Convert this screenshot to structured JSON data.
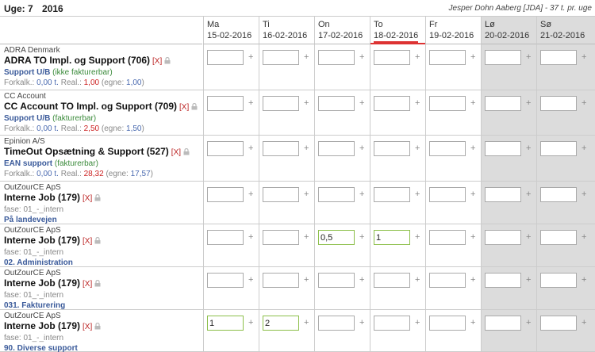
{
  "week": {
    "label": "Uge: 7",
    "year": "2016"
  },
  "user_info": "Jesper Dohn Aaberg [JDA] - 37 t. pr. uge",
  "days": [
    {
      "name": "Ma",
      "date": "15-02-2016"
    },
    {
      "name": "Ti",
      "date": "16-02-2016"
    },
    {
      "name": "On",
      "date": "17-02-2016"
    },
    {
      "name": "To",
      "date": "18-02-2016"
    },
    {
      "name": "Fr",
      "date": "19-02-2016"
    },
    {
      "name": "Lø",
      "date": "20-02-2016"
    },
    {
      "name": "Sø",
      "date": "21-02-2016"
    }
  ],
  "plus_glyph": "+",
  "remove_label": "[X]",
  "rows": [
    {
      "company": "ADRA Denmark",
      "job": "ADRA TO Impl. og Support (706)",
      "task": "Support U/B",
      "billing": "(ikke fakturerbar)",
      "forkalk_label": "Forkalk.:",
      "forkalk": "0,00 t.",
      "real_label": "Real.:",
      "real": "1,00",
      "egne_label": "(egne:",
      "egne": "1,00",
      "egne_close": ")",
      "hours": [
        "",
        "",
        "",
        "",
        "",
        "",
        ""
      ]
    },
    {
      "company": "CC Account",
      "job": "CC Account TO Impl. og Support (709)",
      "task": "Support U/B",
      "billing": "(fakturerbar)",
      "forkalk_label": "Forkalk.:",
      "forkalk": "0,00 t.",
      "real_label": "Real.:",
      "real": "2,50",
      "egne_label": "(egne:",
      "egne": "1,50",
      "egne_close": ")",
      "hours": [
        "",
        "",
        "",
        "",
        "",
        "",
        ""
      ]
    },
    {
      "company": "Epinion A/S",
      "job": "TimeOut Opsætning & Support (527)",
      "task": "EAN support",
      "billing": "(fakturerbar)",
      "forkalk_label": "Forkalk.:",
      "forkalk": "0,00 t.",
      "real_label": "Real.:",
      "real": "28,32",
      "egne_label": "(egne:",
      "egne": "17,57",
      "egne_close": ")",
      "hours": [
        "",
        "",
        "",
        "",
        "",
        "",
        ""
      ]
    },
    {
      "company": "OutZourCE ApS",
      "job": "Interne Job (179)",
      "fase": "fase: 01_-_intern",
      "task": "På landevejen",
      "hours": [
        "",
        "",
        "",
        "",
        "",
        "",
        ""
      ]
    },
    {
      "company": "OutZourCE ApS",
      "job": "Interne Job (179)",
      "fase": "fase: 01_-_intern",
      "task": "02. Administration",
      "hours": [
        "",
        "",
        "0,5",
        "1",
        "",
        "",
        ""
      ]
    },
    {
      "company": "OutZourCE ApS",
      "job": "Interne Job (179)",
      "fase": "fase: 01_-_intern",
      "task": "031. Fakturering",
      "hours": [
        "",
        "",
        "",
        "",
        "",
        "",
        ""
      ]
    },
    {
      "company": "OutZourCE ApS",
      "job": "Interne Job (179)",
      "fase": "fase: 01_-_intern",
      "task": "90. Diverse support",
      "hours": [
        "1",
        "2",
        "",
        "",
        "",
        "",
        ""
      ]
    }
  ]
}
